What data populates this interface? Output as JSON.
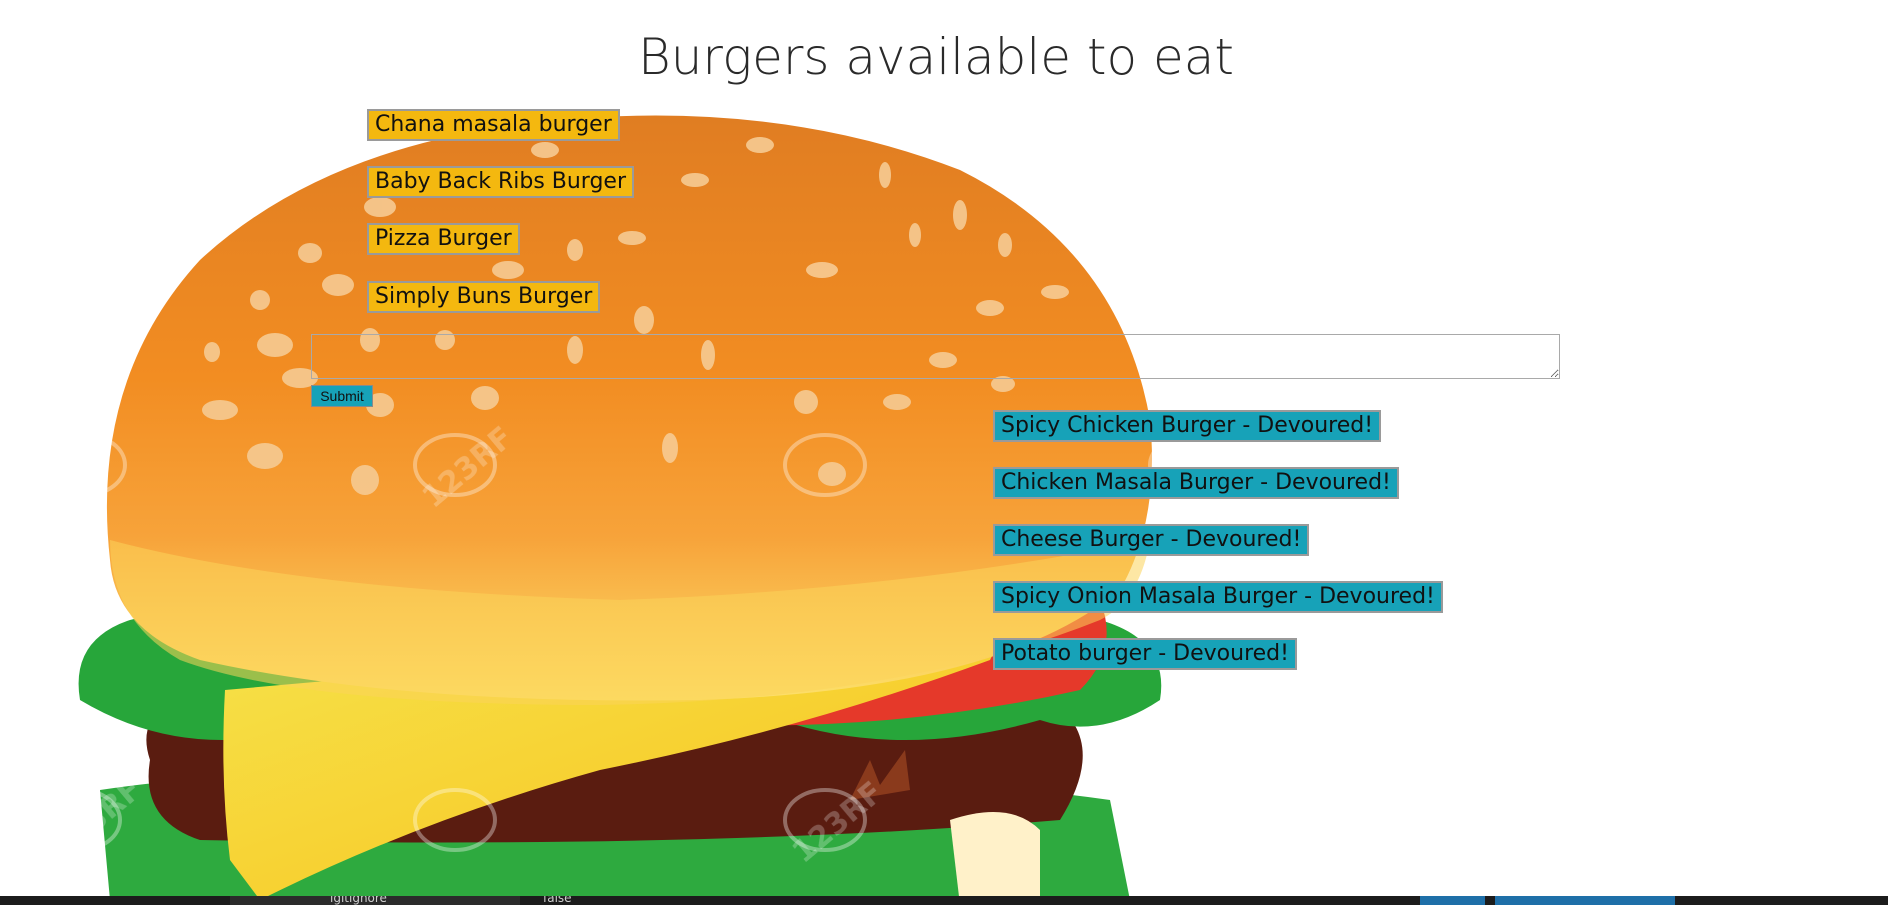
{
  "page": {
    "title": "Burgers available to eat"
  },
  "burgers_to_eat": [
    {
      "label": "Chana masala burger"
    },
    {
      "label": "Baby Back Ribs Burger"
    },
    {
      "label": "Pizza Burger"
    },
    {
      "label": "Simply Buns Burger"
    }
  ],
  "form": {
    "input_value": "",
    "submit_label": "Submit"
  },
  "devoured_burgers": [
    {
      "label": "Spicy Chicken Burger - Devoured!"
    },
    {
      "label": "Chicken Masala Burger - Devoured!"
    },
    {
      "label": "Cheese Burger - Devoured!"
    },
    {
      "label": "Spicy Onion Masala Burger - Devoured!"
    },
    {
      "label": "Potato burger - Devoured!"
    }
  ],
  "taskbar": {
    "item_1": "igitignore",
    "item_2": "false"
  },
  "colors": {
    "to_eat_button": "#f4b80f",
    "devoured_button": "#17a2b8",
    "title_text": "#2a2a2a",
    "bun": "#f08a1e",
    "cheese": "#f7c91e",
    "tomato": "#e5392a",
    "lettuce": "#2eaa3f",
    "patty": "#5a1c10"
  },
  "watermark": "123RF"
}
